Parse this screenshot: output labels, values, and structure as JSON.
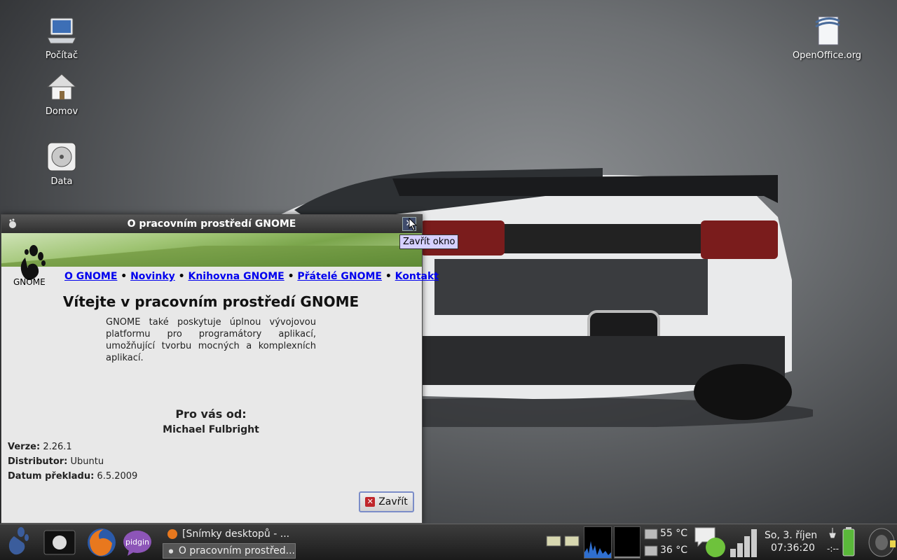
{
  "desktop": {
    "icons": [
      {
        "label": "Počítač",
        "icon": "computer-icon"
      },
      {
        "label": "Domov",
        "icon": "home-icon"
      },
      {
        "label": "Data",
        "icon": "harddisk-icon"
      },
      {
        "label": "OpenOffice.org",
        "icon": "openoffice-icon"
      }
    ]
  },
  "window": {
    "title": "O pracovním prostředí GNOME",
    "tooltip": "Zavřít okno",
    "logo_text": "GNOME",
    "nav": [
      "O GNOME",
      "Novinky",
      "Knihovna GNOME",
      "Přátelé GNOME",
      "Kontakt"
    ],
    "nav_separator": "•",
    "heading": "Vítejte v pracovním prostředí GNOME",
    "description": "GNOME také poskytuje úplnou vývojovou platformu pro programátory aplikací, umožňující tvorbu mocných a komplexních aplikací.",
    "author_heading": "Pro vás od:",
    "author_name": "Michael Fulbright",
    "info": [
      {
        "label": "Verze:",
        "value": "2.26.1"
      },
      {
        "label": "Distributor:",
        "value": "Ubuntu"
      },
      {
        "label": "Datum překladu:",
        "value": "6.5.2009"
      }
    ],
    "close_button": "Zavřít"
  },
  "panel": {
    "tasks": [
      {
        "label": "[Snímky desktopů - ...",
        "active": false
      },
      {
        "label": "O pracovním prostřed...",
        "active": true
      }
    ],
    "temps": [
      "55 °C",
      "36 °C"
    ],
    "date": "So,  3. říjen",
    "time": "07:36:20",
    "battery_text": "-:--"
  },
  "colors": {
    "link": "#0000ee",
    "titlebar": "#3a3a3a",
    "tooltip_bg": "#d5d0ff"
  }
}
